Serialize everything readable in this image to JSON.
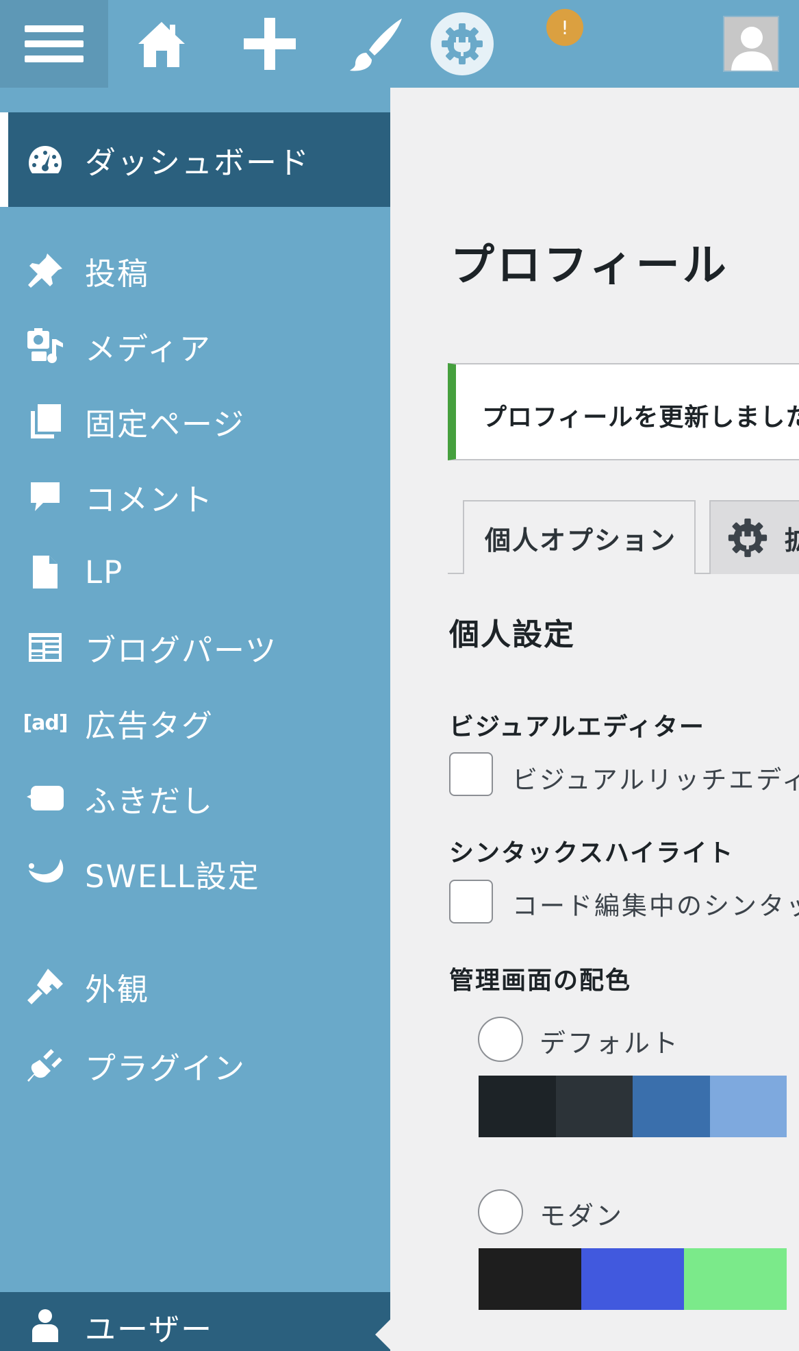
{
  "topbar": {
    "notice_badge": "!",
    "icons": [
      "menu-icon",
      "home-icon",
      "plus-icon",
      "brush-icon",
      "plugin-gear-icon",
      "notice-icon",
      "avatar"
    ]
  },
  "sidebar": {
    "items": [
      {
        "label": "ダッシュボード",
        "icon": "dashboard-icon",
        "current": true
      },
      {
        "label": "投稿",
        "icon": "pin-icon"
      },
      {
        "label": "メディア",
        "icon": "media-icon"
      },
      {
        "label": "固定ページ",
        "icon": "pages-icon"
      },
      {
        "label": "コメント",
        "icon": "comment-icon"
      },
      {
        "label": "LP",
        "icon": "document-icon"
      },
      {
        "label": "ブログパーツ",
        "icon": "blog-parts-icon"
      },
      {
        "label": "広告タグ",
        "icon": "ad-icon",
        "icon_text": "[ad]"
      },
      {
        "label": "ふきだし",
        "icon": "balloon-icon"
      },
      {
        "label": "SWELL設定",
        "icon": "swell-icon"
      },
      {
        "label": "外観",
        "icon": "brush-icon"
      },
      {
        "label": "プラグイン",
        "icon": "plugin-icon"
      },
      {
        "label": "ユーザー",
        "icon": "user-icon",
        "active": true
      }
    ]
  },
  "main": {
    "title": "プロフィール",
    "notice": "プロフィールを更新しました",
    "tabs": [
      {
        "label": "個人オプション",
        "active": true
      },
      {
        "label": "拡",
        "icon": "plugin-gear-icon"
      }
    ],
    "section_title": "個人設定",
    "visual_editor": {
      "heading": "ビジュアルエディター",
      "checkbox_label": "ビジュアルリッチエディ"
    },
    "syntax_highlight": {
      "heading": "シンタックスハイライト",
      "checkbox_label": "コード編集中のシンタッ"
    },
    "color_scheme": {
      "heading": "管理画面の配色",
      "schemes": [
        {
          "label": "デフォルト",
          "colors": [
            "#1d2327",
            "#2c3338",
            "#3a6fac",
            "#7ea9de"
          ]
        },
        {
          "label": "モダン",
          "colors": [
            "#1e1e1e",
            "#4159de",
            "#7bea8a"
          ]
        }
      ]
    }
  },
  "colors": {
    "sidebar_bg": "#6aa9c9",
    "sidebar_current": "#2b607e",
    "notice_success": "#46a03e",
    "badge": "#dba040"
  }
}
